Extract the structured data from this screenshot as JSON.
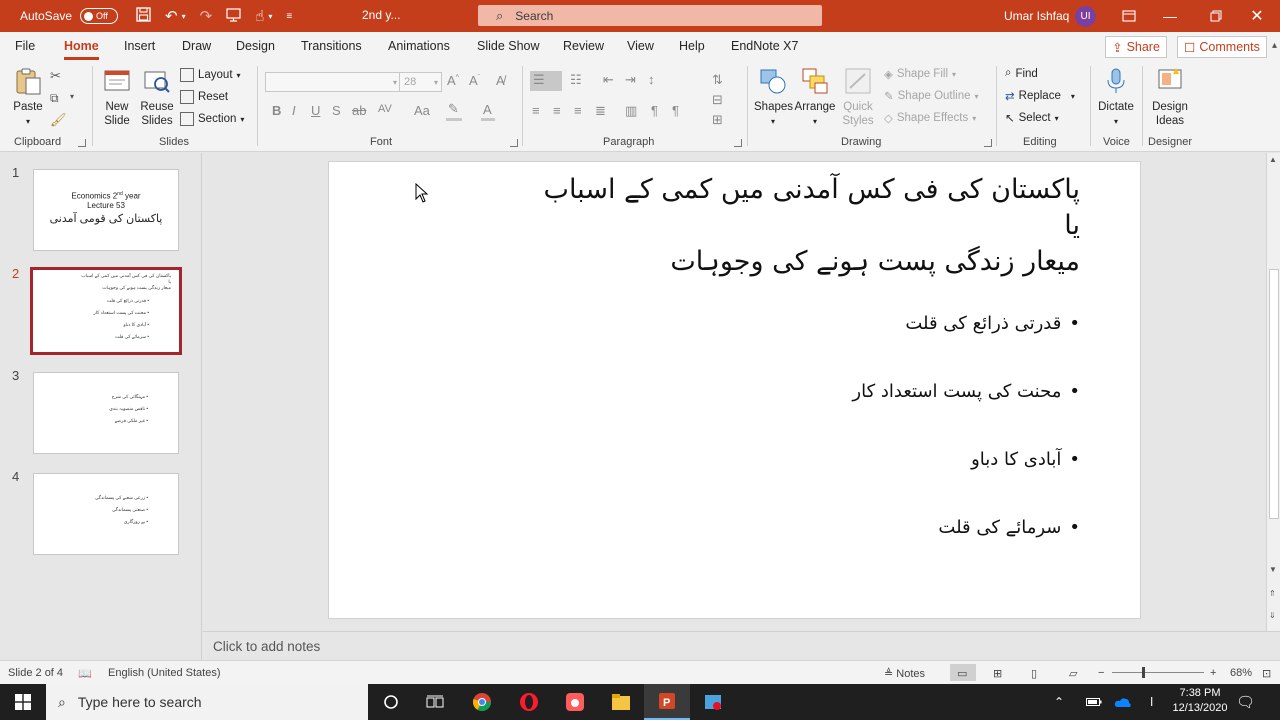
{
  "titlebar": {
    "autosave_label": "AutoSave",
    "autosave_state": "Off",
    "filename": "2nd y...",
    "search_placeholder": "Search",
    "user_name": "Umar Ishfaq",
    "user_initials": "UI"
  },
  "tabs": [
    "File",
    "Home",
    "Insert",
    "Draw",
    "Design",
    "Transitions",
    "Animations",
    "Slide Show",
    "Review",
    "View",
    "Help",
    "EndNote X7"
  ],
  "active_tab": "Home",
  "share_label": "Share",
  "comments_label": "Comments",
  "ribbon": {
    "clipboard": {
      "label": "Clipboard",
      "paste": "Paste"
    },
    "slides": {
      "label": "Slides",
      "new_slide": "New Slide",
      "reuse_slides": "Reuse Slides",
      "layout": "Layout",
      "reset": "Reset",
      "section": "Section"
    },
    "font": {
      "label": "Font",
      "font_size": "28"
    },
    "paragraph": {
      "label": "Paragraph"
    },
    "drawing": {
      "label": "Drawing",
      "shapes": "Shapes",
      "arrange": "Arrange",
      "quick_styles": "Quick Styles",
      "shape_fill": "Shape Fill",
      "shape_outline": "Shape Outline",
      "shape_effects": "Shape Effects"
    },
    "editing": {
      "label": "Editing",
      "find": "Find",
      "replace": "Replace",
      "select": "Select"
    },
    "voice": {
      "label": "Voice",
      "dictate": "Dictate"
    },
    "designer": {
      "label": "Designer",
      "design_ideas": "Design Ideas"
    }
  },
  "thumbnails": [
    {
      "num": "1",
      "title_line1": "Economics 2",
      "title_sup": "nd",
      "title_line1b": " year",
      "title_line2": "Lecture 53",
      "urdu": "پاکستان کی قومی آمدنی"
    },
    {
      "num": "2",
      "lines": [
        "پاکستان کی فی کس آمدنی میں کمی کے اسباب",
        "یا",
        "میعار زندگی پست ہونے کی وجوہات",
        "• قدرتی ذرائع کی قلت",
        "• محنت کی پست استعداد کار",
        "• آبادی کا دباو",
        "• سرمائے کی قلت"
      ]
    },
    {
      "num": "3",
      "lines": [
        "• مہنگائی کی شرح",
        "• ناقص منصوبہ بندی",
        "• غیر ملکی قرضے"
      ]
    },
    {
      "num": "4",
      "lines": [
        "• زرعی شعبے کی پسماندگی",
        "• صنعتی پسماندگی",
        "• بے روزگاری"
      ]
    }
  ],
  "slide": {
    "title_line1": "پاکستان کی فی کس آمدنی  میں کمی کے اسباب",
    "title_line2": "یا",
    "title_line3": "میعار زندگی پست ہونے کی وجوہات",
    "bullets": [
      "قدرتی ذرائع کی قلت",
      "محنت کی پست استعداد کار",
      "آبادی کا دباو",
      "سرمائے کی قلت"
    ]
  },
  "notes_placeholder": "Click to add notes",
  "statusbar": {
    "slide_info": "Slide 2 of 4",
    "language": "English (United States)",
    "notes_label": "Notes",
    "zoom": "68%"
  },
  "taskbar": {
    "search_placeholder": "Type here to search",
    "time": "7:38 PM",
    "date": "12/13/2020",
    "ime": "ا"
  }
}
